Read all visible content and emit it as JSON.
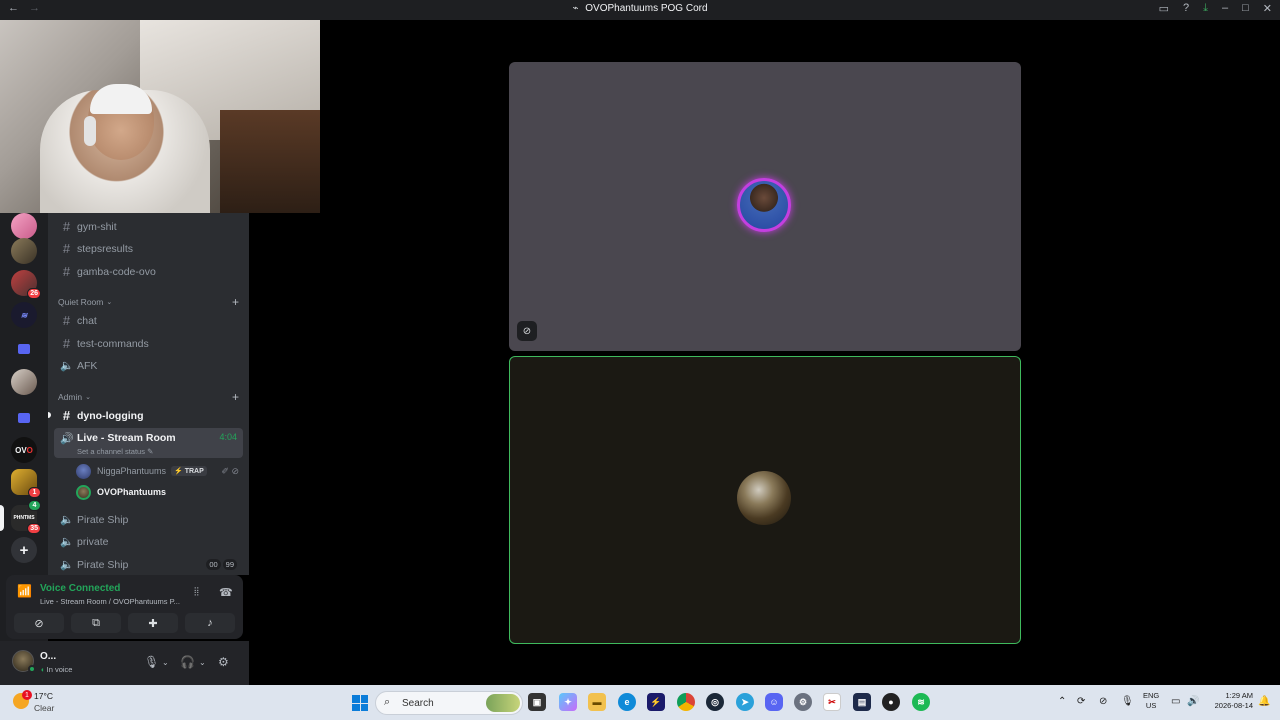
{
  "window": {
    "title": "OVOPhantuums POG Cord",
    "back_icon": "←",
    "forward_icon": "→"
  },
  "server_badges": {
    "s3": "26",
    "s9": "1",
    "s10_top": "4",
    "s10": "35"
  },
  "channels": {
    "top": [
      "gym-shit",
      "stepsresults",
      "gamba-code-ovo"
    ],
    "quiet_room": {
      "label": "Quiet Room",
      "items": [
        "chat",
        "test-commands",
        "AFK"
      ]
    },
    "admin": {
      "label": "Admin",
      "dyno": "dyno-logging",
      "live": "Live - Stream Room",
      "live_timer": "4:04",
      "set_status": "Set a channel status"
    },
    "voice_users": [
      {
        "name": "NiggaPhantuums",
        "tag": "TRAP"
      },
      {
        "name": "OVOPhantuums"
      }
    ],
    "after": [
      "Pirate Ship",
      "private",
      "Pirate Ship"
    ],
    "counts": [
      "00",
      "99"
    ]
  },
  "voice_panel": {
    "title": "Voice Connected",
    "subtitle": "Live - Stream Room / OVOPhantuums P..."
  },
  "user": {
    "name": "O...",
    "status": "In voice"
  },
  "taskbar": {
    "temp": "17°C",
    "condition": "Clear",
    "weather_badge": "1",
    "search_placeholder": "Search",
    "lang_top": "ENG",
    "lang_bottom": "US",
    "time": "1:29 AM",
    "date": "2026-08-14"
  },
  "colors": {
    "accent_green": "#23a55a",
    "speaking_ring": "#c43fe0",
    "tile_border": "#3fba5d"
  }
}
